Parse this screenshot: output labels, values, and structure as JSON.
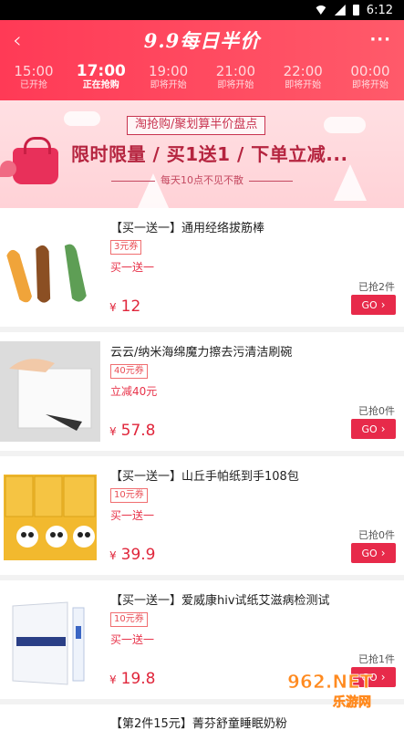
{
  "status_bar": {
    "time": "6:12"
  },
  "header": {
    "back_icon": "back-chevron-icon",
    "title": "9.9每日半价",
    "more_icon": "more-dots-icon",
    "more_glyph": "···",
    "colors": {
      "accent": "#ff3a56"
    }
  },
  "time_tabs": [
    {
      "time": "15:00",
      "status": "已开抢",
      "active": false
    },
    {
      "time": "17:00",
      "status": "正在抢购",
      "active": true
    },
    {
      "time": "19:00",
      "status": "即将开始",
      "active": false
    },
    {
      "time": "21:00",
      "status": "即将开始",
      "active": false
    },
    {
      "time": "22:00",
      "status": "即将开始",
      "active": false
    },
    {
      "time": "00:00",
      "status": "即将开始",
      "active": false
    }
  ],
  "banner": {
    "subtitle": "淘抢购/聚划算半价盘点",
    "title": "限时限量 / 买1送1 / 下单立减...",
    "tagline": "每天10点不见不散"
  },
  "products": [
    {
      "name": "【买一送一】通用经络拔筋棒",
      "coupon": "3元券",
      "promo": "买一送一",
      "sold": "已抢2件",
      "price": "12",
      "currency": "¥",
      "go": "GO"
    },
    {
      "name": "云云/纳米海绵魔力擦去污清洁刷碗",
      "coupon": "40元券",
      "promo": "立减40元",
      "sold": "已抢0件",
      "price": "57.8",
      "currency": "¥",
      "go": "GO"
    },
    {
      "name": "【买一送一】山丘手帕纸到手108包",
      "coupon": "10元券",
      "promo": "买一送一",
      "sold": "已抢0件",
      "price": "39.9",
      "currency": "¥",
      "go": "GO"
    },
    {
      "name": "【买一送一】爱威康hiv试纸艾滋病检测试",
      "coupon": "10元券",
      "promo": "买一送一",
      "sold": "已抢1件",
      "price": "19.8",
      "currency": "¥",
      "go": "GO"
    }
  ],
  "peek_item": {
    "name": "【第2件15元】菁芬舒童睡眠奶粉"
  },
  "watermark": {
    "text": "962.NET 乐游网"
  }
}
